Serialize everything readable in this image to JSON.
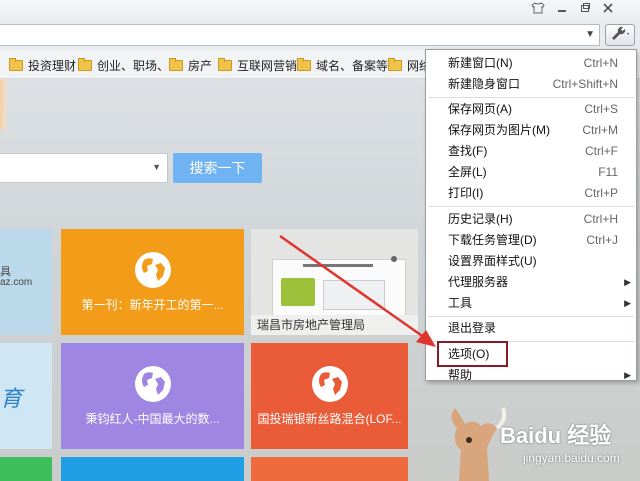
{
  "window": {
    "buttons": [
      "shirt-icon",
      "minimize-icon",
      "restore-icon",
      "close-icon"
    ]
  },
  "bookmarks": [
    {
      "label": "投资理财"
    },
    {
      "label": "创业、职场、"
    },
    {
      "label": "房产"
    },
    {
      "label": "互联网营销"
    },
    {
      "label": "域名、备案等"
    },
    {
      "label": "网络"
    }
  ],
  "search": {
    "button_label": "搜索一下"
  },
  "tiles": {
    "left_top_text": "具",
    "left_top_sub": "az.com",
    "orange_label": "第一刊：新年开工的第一...",
    "gray_caption": "瑞昌市房地产管理局",
    "left_mid_text": "育",
    "purple_label": "秉钧红人-中国最大的数...",
    "red_label": "国投瑞银新丝路混合(LOF..."
  },
  "menu": {
    "items": [
      {
        "label": "新建窗口(N)",
        "shortcut": "Ctrl+N"
      },
      {
        "label": "新建隐身窗口",
        "shortcut": "Ctrl+Shift+N"
      },
      {
        "label": "保存网页(A)",
        "shortcut": "Ctrl+S"
      },
      {
        "label": "保存网页为图片(M)",
        "shortcut": "Ctrl+M"
      },
      {
        "label": "查找(F)",
        "shortcut": "Ctrl+F"
      },
      {
        "label": "全屏(L)",
        "shortcut": "F11"
      },
      {
        "label": "打印(I)",
        "shortcut": "Ctrl+P"
      },
      {
        "label": "历史记录(H)",
        "shortcut": "Ctrl+H"
      },
      {
        "label": "下载任务管理(D)",
        "shortcut": "Ctrl+J"
      },
      {
        "label": "设置界面样式(U)",
        "shortcut": ""
      },
      {
        "label": "代理服务器",
        "shortcut": ""
      },
      {
        "label": "工具",
        "shortcut": ""
      },
      {
        "label": "退出登录",
        "shortcut": ""
      },
      {
        "label": "选项(O)",
        "shortcut": ""
      },
      {
        "label": "帮助",
        "shortcut": ""
      }
    ]
  },
  "watermark": {
    "brand": "Baidu 经验",
    "url": "jingyan.baidu.com"
  },
  "colors": {
    "highlight": "#8a1a25",
    "arrow": "#e0342f"
  }
}
